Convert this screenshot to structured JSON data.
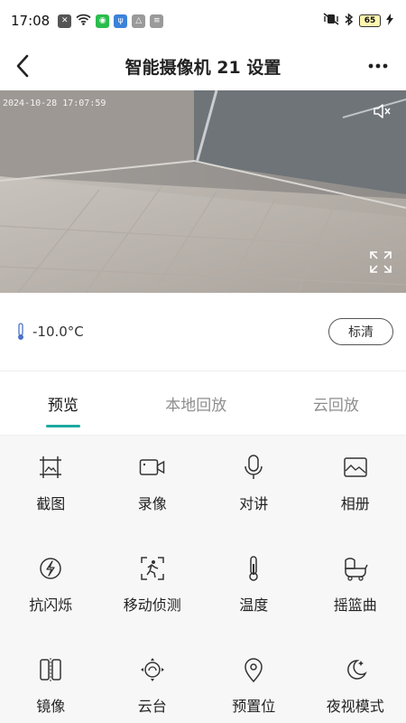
{
  "status_bar": {
    "time": "17:08",
    "battery": "65"
  },
  "header": {
    "title": "智能摄像机 21 设置"
  },
  "video": {
    "timestamp": "2024-10-28 17:07:59"
  },
  "info": {
    "temperature": "-10.0°C",
    "quality_label": "标清"
  },
  "tabs": [
    {
      "label": "预览",
      "active": true
    },
    {
      "label": "本地回放",
      "active": false
    },
    {
      "label": "云回放",
      "active": false
    }
  ],
  "features": [
    {
      "label": "截图",
      "icon": "screenshot-icon"
    },
    {
      "label": "录像",
      "icon": "video-record-icon"
    },
    {
      "label": "对讲",
      "icon": "microphone-icon"
    },
    {
      "label": "相册",
      "icon": "album-icon"
    },
    {
      "label": "抗闪烁",
      "icon": "anti-flicker-icon"
    },
    {
      "label": "移动侦测",
      "icon": "motion-detect-icon"
    },
    {
      "label": "温度",
      "icon": "thermometer-icon"
    },
    {
      "label": "摇篮曲",
      "icon": "cradle-icon"
    },
    {
      "label": "镜像",
      "icon": "mirror-icon"
    },
    {
      "label": "云台",
      "icon": "ptz-icon"
    },
    {
      "label": "预置位",
      "icon": "location-pin-icon"
    },
    {
      "label": "夜视模式",
      "icon": "night-vision-icon"
    }
  ],
  "colors": {
    "accent": "#1ba9a1"
  }
}
